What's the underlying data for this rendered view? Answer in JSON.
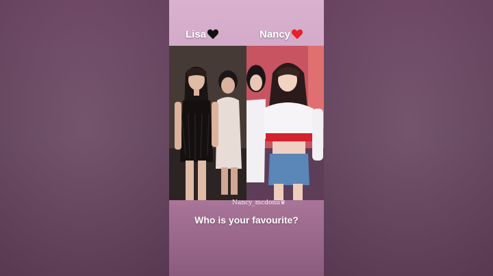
{
  "left_label": "Lisa",
  "right_label": "Nancy",
  "left_heart_icon": "black-heart-icon",
  "right_heart_icon": "red-heart-icon",
  "watermark": "Nancy_mcdonii♛",
  "question": "Who is your favourite?",
  "colors": {
    "black_heart": "#111111",
    "red_heart": "#e8202a",
    "background": "#6e4a66"
  }
}
